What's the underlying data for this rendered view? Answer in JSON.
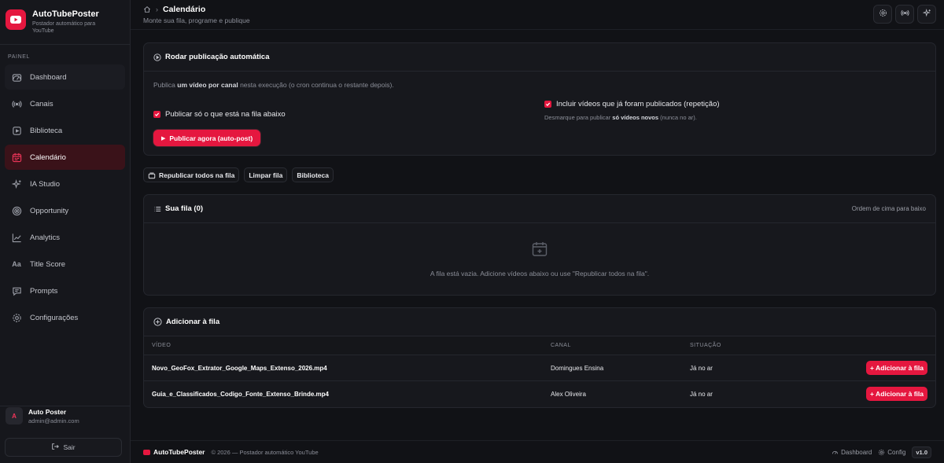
{
  "brand": {
    "name": "AutoTubePoster",
    "subtitle": "Postador automático para YouTube"
  },
  "sidebar": {
    "section_label": "PAINEL",
    "items": [
      {
        "label": "Dashboard",
        "icon": "gauge-icon"
      },
      {
        "label": "Canais",
        "icon": "broadcast-icon"
      },
      {
        "label": "Biblioteca",
        "icon": "library-icon"
      },
      {
        "label": "Calendário",
        "icon": "calendar-icon"
      },
      {
        "label": "IA Studio",
        "icon": "sparkles-icon"
      },
      {
        "label": "Opportunity",
        "icon": "target-icon"
      },
      {
        "label": "Analytics",
        "icon": "chart-line-icon"
      },
      {
        "label": "Title Score",
        "icon": "text-size-icon"
      },
      {
        "label": "Prompts",
        "icon": "message-icon"
      },
      {
        "label": "Configurações",
        "icon": "gear-icon"
      }
    ],
    "user": {
      "initial": "A",
      "name": "Auto Poster",
      "email": "admin@admin.com"
    },
    "logout_label": "Sair"
  },
  "header": {
    "title": "Calendário",
    "subtitle": "Monte sua fila, programe e publique"
  },
  "autopost": {
    "title": "Rodar publicação automática",
    "desc_prefix": "Publica ",
    "desc_bold": "um vídeo por canal",
    "desc_suffix": " nesta execução (o cron continua o restante depois).",
    "check_queue_only": "Publicar só o que está na fila abaixo",
    "check_include_published": "Incluir vídeos que já foram publicados (repetição)",
    "hint_prefix": "Desmarque para publicar ",
    "hint_bold": "só vídeos novos",
    "hint_suffix": " (nunca no ar).",
    "publish_button": "Publicar agora (auto-post)"
  },
  "actions": {
    "republish_all": "Republicar todos na fila",
    "clear_queue": "Limpar fila",
    "library": "Biblioteca"
  },
  "queue": {
    "title": "Sua fila (0)",
    "order_hint": "Ordem de cima para baixo",
    "empty_text": "A fila está vazia. Adicione vídeos abaixo ou use \"Republicar todos na fila\"."
  },
  "add_queue": {
    "title": "Adicionar à fila",
    "columns": [
      "VÍDEO",
      "CANAL",
      "SITUAÇÃO"
    ],
    "rows": [
      {
        "video": "Novo_GeoFox_Extrator_Google_Maps_Extenso_2026.mp4",
        "channel": "Domingues Ensina",
        "status": "Já no ar",
        "button": "+ Adicionar à fila"
      },
      {
        "video": "Guia_e_Classificados_Codigo_Fonte_Extenso_Brinde.mp4",
        "channel": "Alex Oliveira",
        "status": "Já no ar",
        "button": "+ Adicionar à fila"
      }
    ]
  },
  "footer": {
    "brand": "AutoTubePoster",
    "copyright": "© 2026 — Postador automático YouTube",
    "dashboard": "Dashboard",
    "config": "Config",
    "version": "v1.0"
  },
  "colors": {
    "accent": "#e5173f",
    "background": "#111216",
    "sidebar": "#16171c",
    "card": "#17181d"
  }
}
